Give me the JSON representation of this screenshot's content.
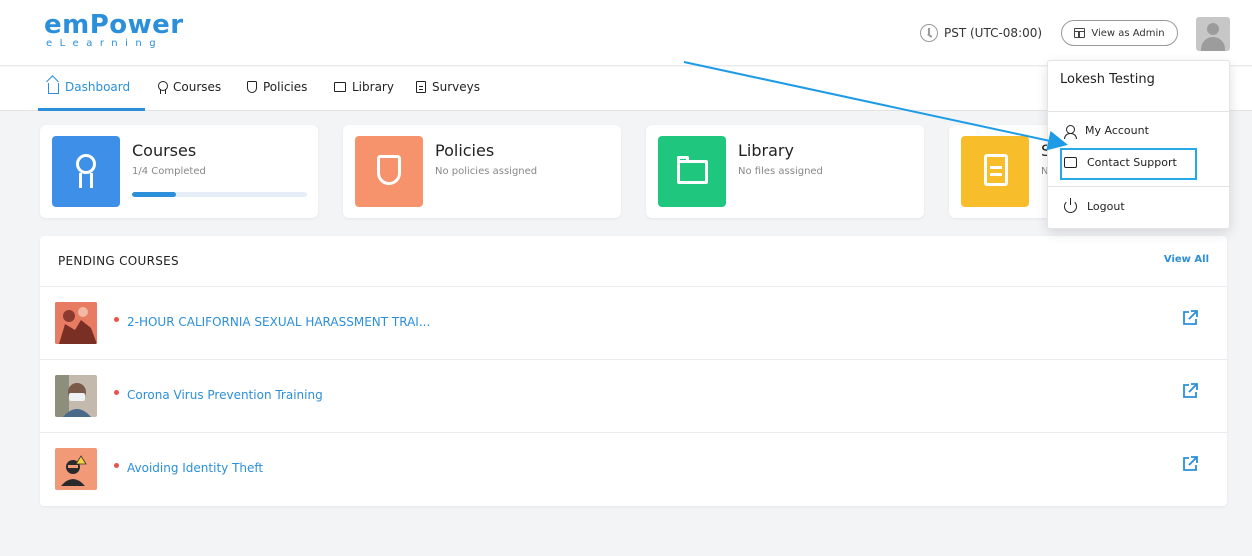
{
  "brand": {
    "logo_main": "emPower",
    "logo_sub": "eLearning"
  },
  "header": {
    "timezone": "PST (UTC-08:00)",
    "view_as_admin": "View as Admin",
    "clock_icon": "clock-icon",
    "avatar_icon": "user-avatar"
  },
  "nav": {
    "tabs": [
      {
        "label": "Dashboard",
        "icon": "home-icon",
        "active": true
      },
      {
        "label": "Courses",
        "icon": "award-icon"
      },
      {
        "label": "Policies",
        "icon": "shield-icon"
      },
      {
        "label": "Library",
        "icon": "folder-icon"
      },
      {
        "label": "Surveys",
        "icon": "document-icon"
      }
    ]
  },
  "cards": [
    {
      "title": "Courses",
      "subtitle": "1/4 Completed",
      "color": "#3d8fe8",
      "progress": 0.25,
      "icon": "award-icon"
    },
    {
      "title": "Policies",
      "subtitle": "No policies assigned",
      "color": "#f7936c",
      "icon": "shield-icon"
    },
    {
      "title": "Library",
      "subtitle": "No files assigned",
      "color": "#1ec77d",
      "icon": "folder-icon"
    },
    {
      "title": "S",
      "subtitle": "N",
      "color": "#f7bd2b",
      "icon": "document-icon"
    }
  ],
  "pending": {
    "title": "PENDING COURSES",
    "view_all": "View All",
    "courses": [
      {
        "name": "2-HOUR CALIFORNIA SEXUAL HARASSMENT TRAI...",
        "thumb_color": "#e87c62"
      },
      {
        "name": "Corona Virus Prevention Training",
        "thumb_color": "#c4b9ad"
      },
      {
        "name": "Avoiding Identity Theft",
        "thumb_color": "#f29a78"
      }
    ]
  },
  "user_menu": {
    "user_name": "Lokesh Testing",
    "items": [
      {
        "label": "My Account",
        "icon": "user-icon"
      },
      {
        "label": "Contact Support",
        "icon": "chat-icon"
      },
      {
        "label": "Logout",
        "icon": "power-icon"
      }
    ]
  },
  "colors": {
    "accent": "#2b8fd9",
    "highlight": "#29a8e8",
    "pending_dot": "#e8534c"
  }
}
